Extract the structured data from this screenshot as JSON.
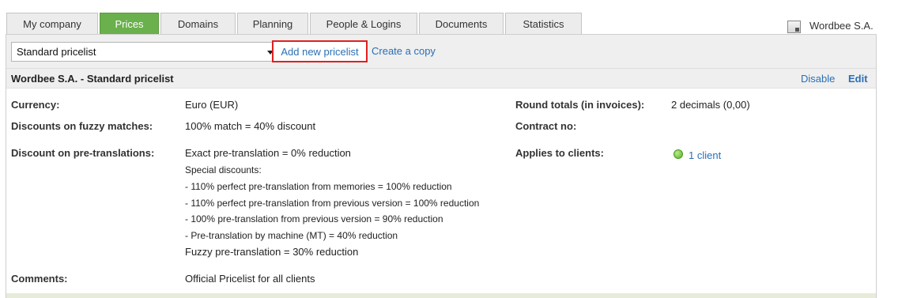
{
  "tabs": [
    {
      "label": "My company",
      "active": false
    },
    {
      "label": "Prices",
      "active": true
    },
    {
      "label": "Domains",
      "active": false
    },
    {
      "label": "Planning",
      "active": false
    },
    {
      "label": "People & Logins",
      "active": false
    },
    {
      "label": "Documents",
      "active": false
    },
    {
      "label": "Statistics",
      "active": false
    }
  ],
  "company": {
    "name": "Wordbee S.A.",
    "icon": "building-icon"
  },
  "toolbar": {
    "pricelist_select": "Standard pricelist",
    "add_new": "Add new pricelist",
    "create_copy": "Create a copy"
  },
  "pricelist": {
    "title": "Wordbee S.A. - Standard pricelist",
    "disable": "Disable",
    "edit": "Edit"
  },
  "fields": {
    "currency_label": "Currency:",
    "currency_value": "Euro (EUR)",
    "fuzzy_label": "Discounts on fuzzy matches:",
    "fuzzy_value": "100% match = 40% discount",
    "pretrans_label": "Discount on pre-translations:",
    "pretrans_lines": [
      "Exact pre-translation = 0% reduction",
      "Special discounts:",
      "- 110% perfect pre-translation from memories = 100% reduction",
      "- 110% perfect pre-translation from previous version = 100% reduction",
      "- 100% pre-translation from previous version = 90% reduction",
      "- Pre-translation by machine (MT) = 40% reduction",
      "Fuzzy pre-translation = 30% reduction"
    ],
    "comments_label": "Comments:",
    "comments_value": "Official Pricelist for all clients",
    "round_label": "Round totals (in invoices):",
    "round_value": "2 decimals (0,00)",
    "contract_label": "Contract no:",
    "applies_label": "Applies to clients:",
    "applies_value": "1 client"
  },
  "colors": {
    "accent": "#6ab04c",
    "link": "#2a6fb5",
    "highlight": "#e02020"
  }
}
